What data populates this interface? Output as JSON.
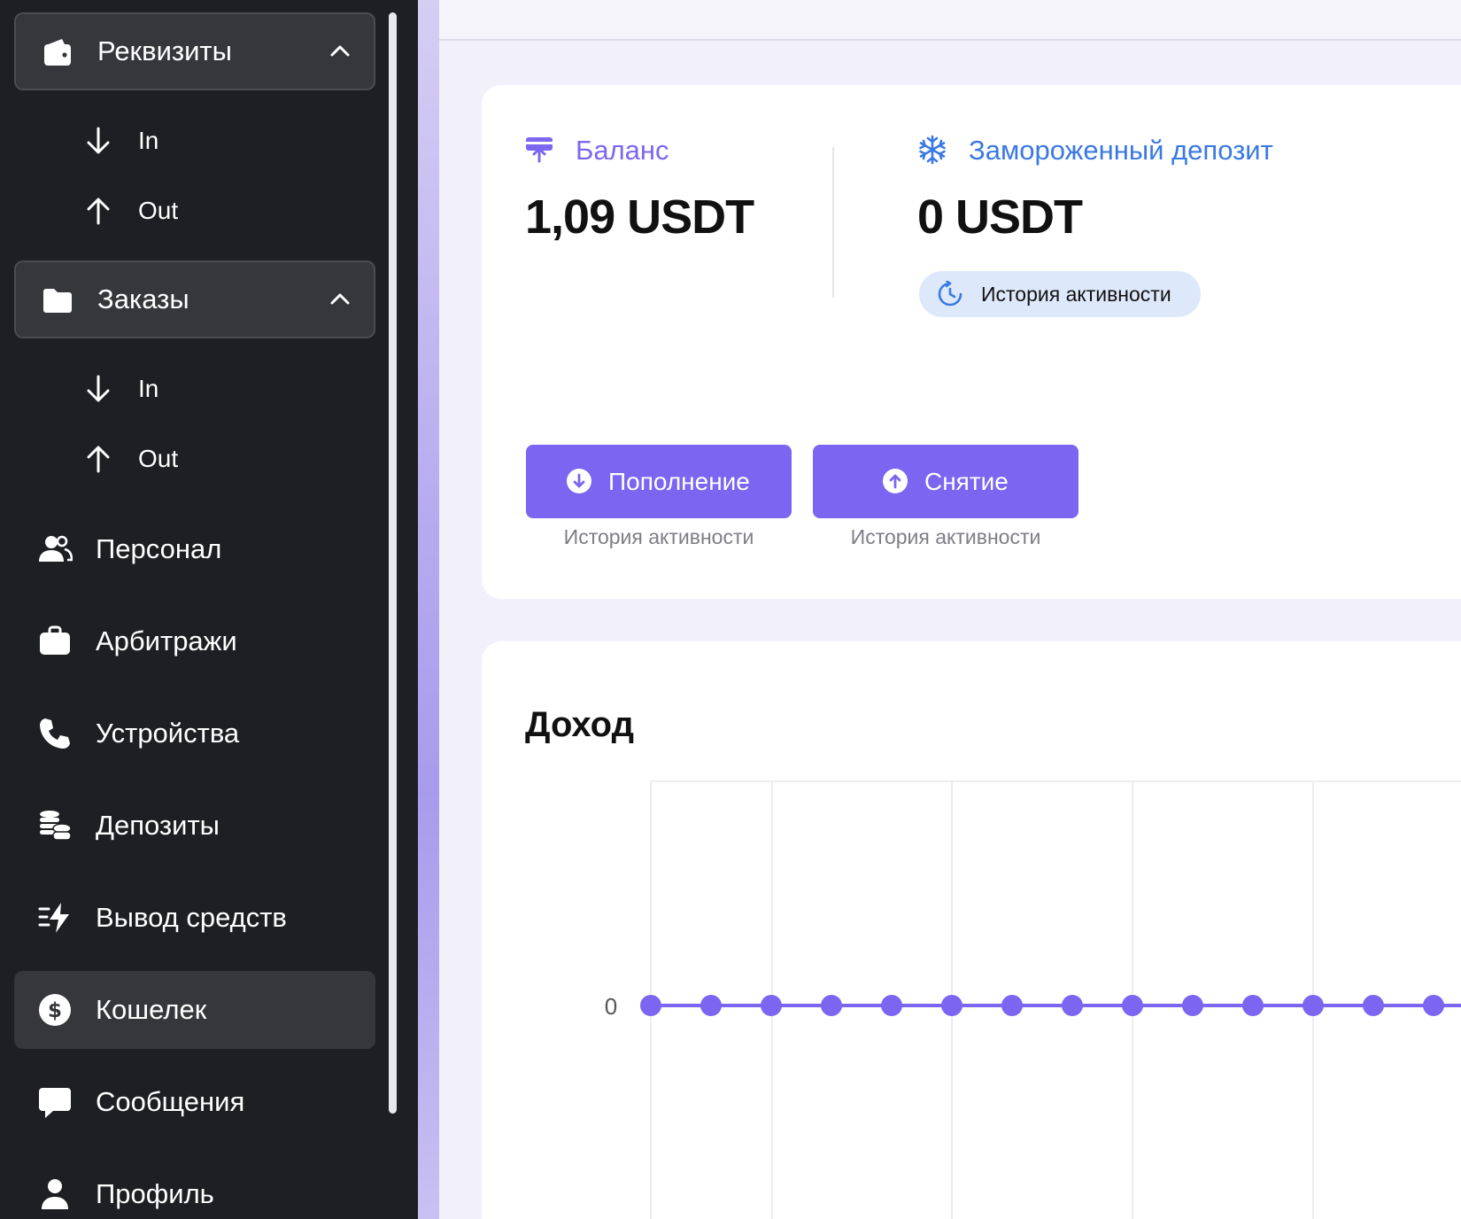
{
  "sidebar": {
    "groups": [
      {
        "label": "Реквизиты",
        "icon": "wallet-icon",
        "items": [
          {
            "label": "In",
            "icon": "arrow-down-icon"
          },
          {
            "label": "Out",
            "icon": "arrow-up-icon"
          }
        ]
      },
      {
        "label": "Заказы",
        "icon": "folder-icon",
        "items": [
          {
            "label": "In",
            "icon": "arrow-down-icon"
          },
          {
            "label": "Out",
            "icon": "arrow-up-icon"
          }
        ]
      }
    ],
    "items": [
      {
        "label": "Персонал",
        "icon": "users-icon"
      },
      {
        "label": "Арбитражи",
        "icon": "briefcase-icon"
      },
      {
        "label": "Устройства",
        "icon": "phone-icon"
      },
      {
        "label": "Депозиты",
        "icon": "coins-icon"
      },
      {
        "label": "Вывод средств",
        "icon": "lightning-icon"
      },
      {
        "label": "Кошелек",
        "icon": "dollar-circle-icon",
        "active": true
      },
      {
        "label": "Сообщения",
        "icon": "chat-icon"
      },
      {
        "label": "Профиль",
        "icon": "user-icon"
      }
    ]
  },
  "balance": {
    "label": "Баланс",
    "value": "1,09 USDT"
  },
  "frozen": {
    "label": "Замороженный депозит",
    "value": "0 USDT",
    "history_label": "История активности"
  },
  "actions": {
    "deposit": {
      "label": "Пополнение",
      "sub": "История активности"
    },
    "withdraw": {
      "label": "Снятие",
      "sub": "История активности"
    }
  },
  "income": {
    "title": "Доход"
  },
  "colors": {
    "accent": "#7b65f1",
    "frozen_blue": "#3a78e3",
    "sidebar_bg": "#1e1f22"
  },
  "chart_data": {
    "type": "line",
    "title": "Доход",
    "y_tick_labels": [
      "0"
    ],
    "series": [
      {
        "values": [
          0,
          0,
          0,
          0,
          0,
          0,
          0,
          0,
          0,
          0,
          0,
          0,
          0,
          0
        ]
      }
    ],
    "grid": true,
    "color": "#7b65f1"
  }
}
